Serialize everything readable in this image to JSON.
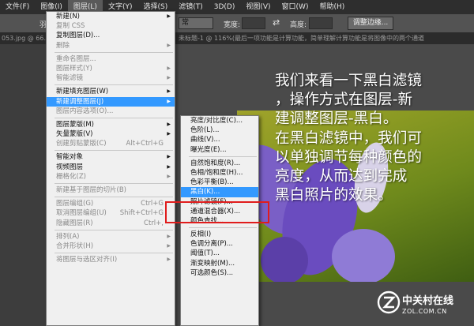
{
  "menubar": {
    "items": [
      "文件(F)",
      "图像(I)",
      "图层(L)",
      "文字(Y)",
      "选择(S)",
      "滤镜(T)",
      "3D(D)",
      "视图(V)",
      "窗口(W)",
      "帮助(H)"
    ],
    "active_index": 2
  },
  "options_bar": {
    "left_label": "羽",
    "dropdown_value": "常",
    "width_label": "宽度:",
    "height_label": "高度:",
    "swap_icon": "⇄",
    "refine_edge_label": "调整边缘..."
  },
  "tabbar": {
    "left_text": "053.jpg @ 66.9",
    "doc_text": "未标题-1 @ 116%(最后一项功能是计算功能，简单理解计算功能是将图像中的两个通道"
  },
  "main_menu": {
    "items": [
      {
        "label": "新建(N)",
        "arrow": true,
        "disabled": false
      },
      {
        "label": "复制 CSS",
        "disabled": true
      },
      {
        "label": "复制图层(D)...",
        "disabled": false
      },
      {
        "label": "删除",
        "arrow": true,
        "disabled": true
      },
      {
        "sep": true
      },
      {
        "label": "重命名图层...",
        "disabled": true
      },
      {
        "label": "图层样式(Y)",
        "arrow": true,
        "disabled": true
      },
      {
        "label": "智能滤镜",
        "arrow": true,
        "disabled": true
      },
      {
        "sep": true
      },
      {
        "label": "新建填充图层(W)",
        "arrow": true,
        "disabled": false
      },
      {
        "label": "新建调整图层(J)",
        "arrow": true,
        "disabled": false,
        "highlight": true
      },
      {
        "label": "图层内容选项(O)...",
        "disabled": true
      },
      {
        "sep": true
      },
      {
        "label": "图层蒙版(M)",
        "arrow": true,
        "disabled": false
      },
      {
        "label": "矢量蒙版(V)",
        "arrow": true,
        "disabled": false
      },
      {
        "label": "创建剪贴蒙版(C)",
        "shortcut": "Alt+Ctrl+G",
        "disabled": true
      },
      {
        "sep": true
      },
      {
        "label": "智能对象",
        "arrow": true,
        "disabled": false
      },
      {
        "label": "视频图层",
        "arrow": true,
        "disabled": false
      },
      {
        "label": "栅格化(Z)",
        "arrow": true,
        "disabled": true
      },
      {
        "sep": true
      },
      {
        "label": "新建基于图层的切片(B)",
        "disabled": true
      },
      {
        "sep": true
      },
      {
        "label": "图层编组(G)",
        "shortcut": "Ctrl+G",
        "disabled": true
      },
      {
        "label": "取消图层编组(U)",
        "shortcut": "Shift+Ctrl+G",
        "disabled": true
      },
      {
        "label": "隐藏图层(R)",
        "shortcut": "Ctrl+,",
        "disabled": true
      },
      {
        "sep": true
      },
      {
        "label": "排列(A)",
        "arrow": true,
        "disabled": true
      },
      {
        "label": "合并形状(H)",
        "arrow": true,
        "disabled": true
      },
      {
        "sep": true
      },
      {
        "label": "将图层与选区对齐(I)",
        "arrow": true,
        "disabled": true
      }
    ]
  },
  "sub_menu": {
    "items": [
      {
        "label": "亮度/对比度(C)..."
      },
      {
        "label": "色阶(L)..."
      },
      {
        "label": "曲线(V)..."
      },
      {
        "label": "曝光度(E)..."
      },
      {
        "sep": true
      },
      {
        "label": "自然饱和度(R)..."
      },
      {
        "label": "色相/饱和度(H)..."
      },
      {
        "label": "色彩平衡(B)..."
      },
      {
        "label": "黑白(K)...",
        "highlight": true
      },
      {
        "label": "照片滤镜(F)..."
      },
      {
        "label": "通道混合器(X)..."
      },
      {
        "label": "颜色查找..."
      },
      {
        "sep": true
      },
      {
        "label": "反相(I)"
      },
      {
        "label": "色调分离(P)..."
      },
      {
        "label": "阈值(T)..."
      },
      {
        "label": "渐变映射(M)..."
      },
      {
        "label": "可选颜色(S)..."
      }
    ]
  },
  "overlay_text": {
    "lines": [
      "我们来看一下黑白滤镜",
      "，操作方式在图层-新",
      "建调整图层-黑白。",
      "在黑白滤镜中，我们可",
      "以单独调节每种颜色的",
      "亮度，从而达到完成",
      "黑白照片的效果。"
    ]
  },
  "watermark": {
    "cn": "中关村在线",
    "en": "ZOL.COM.CN",
    "logo_icon": "zol-logo-icon"
  },
  "colors": {
    "highlight": "#3399ff",
    "redbox": "#e01c1c"
  }
}
